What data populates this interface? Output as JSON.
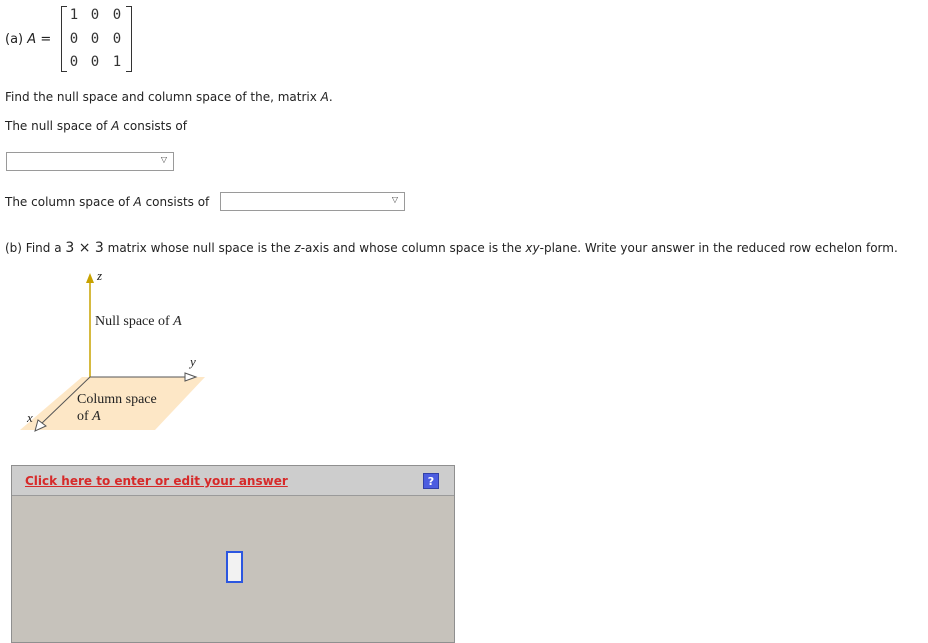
{
  "part_a": {
    "label_prefix": "(a)",
    "matrix_name": "A",
    "equals": "=",
    "matrix": [
      [
        "1",
        "0",
        "0"
      ],
      [
        "0",
        "0",
        "0"
      ],
      [
        "0",
        "0",
        "1"
      ]
    ],
    "instruction_start": "Find the null space and column space of the, matrix ",
    "instruction_var": "A",
    "instruction_end": ".",
    "null_space_start": "The null space of ",
    "null_space_var": "A",
    "null_space_end": " consists of",
    "column_space_start": "The column space of ",
    "column_space_var": "A",
    "column_space_end": " consists of"
  },
  "part_b": {
    "prefix": "(b) Find a ",
    "dims": "3 × 3",
    "middle1": " matrix whose null space is the ",
    "axis_var": "z",
    "middle2": "-axis and whose column space is the ",
    "plane_var": "xy",
    "end": "-plane. Write your answer in the reduced row echelon form."
  },
  "figure": {
    "axis_z": "z",
    "axis_y": "y",
    "axis_x": "x",
    "null_space_label": "Null space of ",
    "null_space_var": "A",
    "column_space_line1": "Column space",
    "column_space_line2": "of ",
    "column_space_var": "A"
  },
  "answer_panel": {
    "edit_link": "Click here to enter or edit your answer",
    "help_button": "?"
  },
  "icons": {
    "dropdown": "triangle-down",
    "help": "question-mark"
  },
  "colors": {
    "link": "#d62a2a",
    "help_button": "#4c5de0",
    "panel_bg": "#c6c2bb",
    "plane_fill": "#fde7c6",
    "z_axis": "#c8a200"
  }
}
